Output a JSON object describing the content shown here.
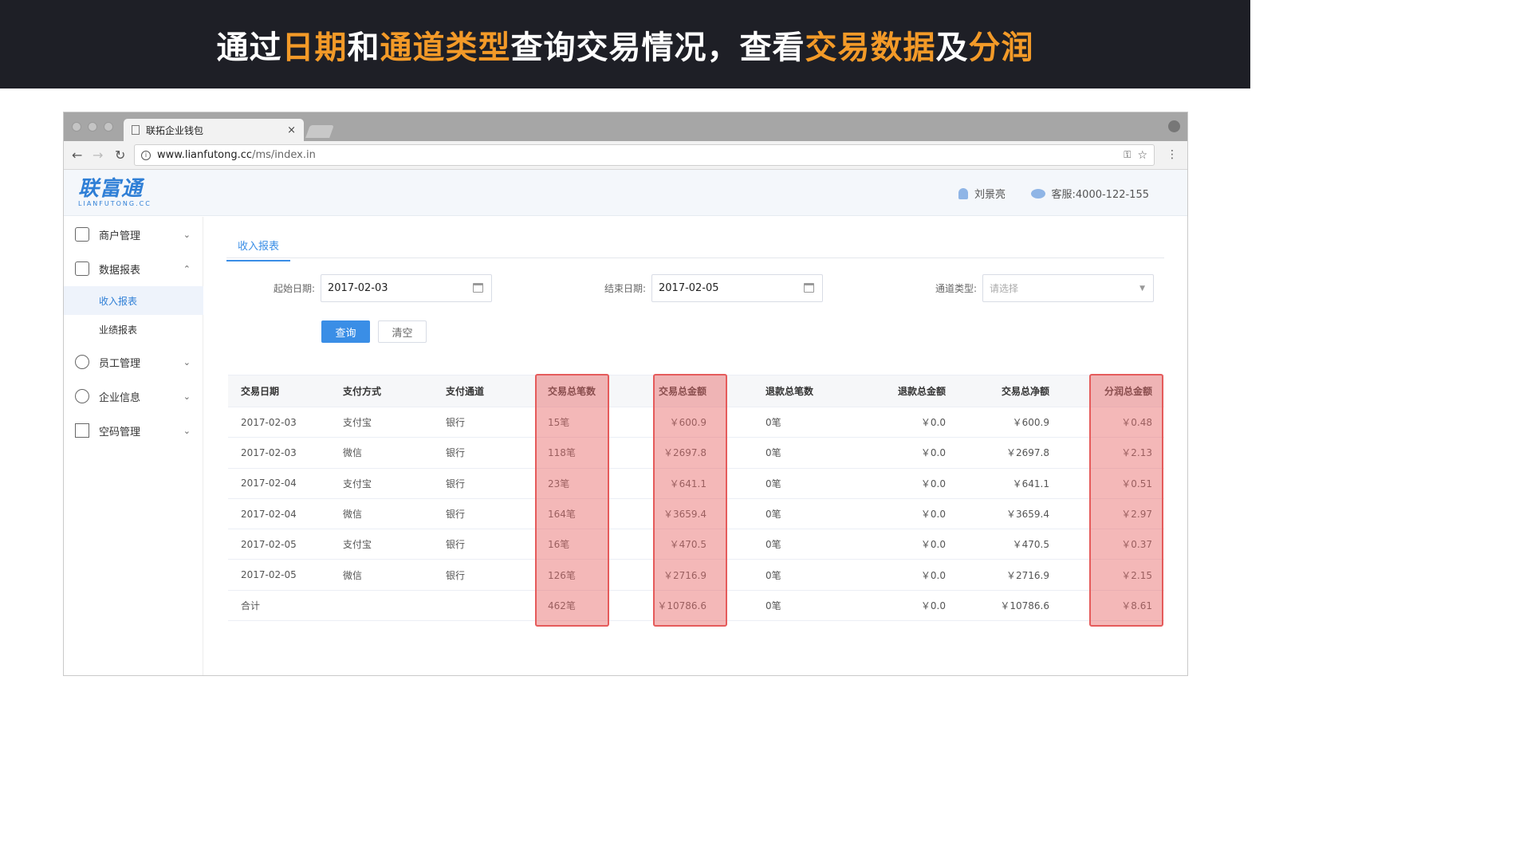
{
  "banner": {
    "parts": [
      {
        "text": "通过",
        "hl": false
      },
      {
        "text": "日期",
        "hl": true
      },
      {
        "text": "和",
        "hl": false
      },
      {
        "text": "通道类型",
        "hl": true
      },
      {
        "text": "查询交易情况，查看",
        "hl": false
      },
      {
        "text": "交易数据",
        "hl": true
      },
      {
        "text": "及",
        "hl": false
      },
      {
        "text": "分润",
        "hl": true
      }
    ]
  },
  "browser": {
    "tab_title": "联拓企业钱包",
    "close": "×",
    "url_host": "www.lianfutong.cc",
    "url_path": "/ms/index.in"
  },
  "header": {
    "logo_main": "联富通",
    "logo_sub": "LIANFUTONG.CC",
    "user_name": "刘景亮",
    "service": "客服:4000-122-155"
  },
  "sidebar": {
    "items": [
      {
        "label": "商户管理",
        "chev": "⌄"
      },
      {
        "label": "数据报表",
        "chev": "⌃"
      },
      {
        "label": "员工管理",
        "chev": "⌄"
      },
      {
        "label": "企业信息",
        "chev": "⌄"
      },
      {
        "label": "空码管理",
        "chev": "⌄"
      }
    ],
    "sub_items": [
      {
        "label": "收入报表"
      },
      {
        "label": "业绩报表"
      }
    ]
  },
  "main": {
    "tab": "收入报表",
    "filters": {
      "start_label": "起始日期:",
      "start_value": "2017-02-03",
      "end_label": "结束日期:",
      "end_value": "2017-02-05",
      "channel_label": "通道类型:",
      "channel_placeholder": "请选择"
    },
    "query_button": "查询",
    "clear_button": "清空"
  },
  "table": {
    "columns": [
      "交易日期",
      "支付方式",
      "支付通道",
      "交易总笔数",
      "交易总金额",
      "退款总笔数",
      "退款总金额",
      "交易总净额",
      "分润总金额"
    ],
    "rows": [
      [
        "2017-02-03",
        "支付宝",
        "银行",
        "15笔",
        "￥600.9",
        "0笔",
        "￥0.0",
        "￥600.9",
        "￥0.48"
      ],
      [
        "2017-02-03",
        "微信",
        "银行",
        "118笔",
        "￥2697.8",
        "0笔",
        "￥0.0",
        "￥2697.8",
        "￥2.13"
      ],
      [
        "2017-02-04",
        "支付宝",
        "银行",
        "23笔",
        "￥641.1",
        "0笔",
        "￥0.0",
        "￥641.1",
        "￥0.51"
      ],
      [
        "2017-02-04",
        "微信",
        "银行",
        "164笔",
        "￥3659.4",
        "0笔",
        "￥0.0",
        "￥3659.4",
        "￥2.97"
      ],
      [
        "2017-02-05",
        "支付宝",
        "银行",
        "16笔",
        "￥470.5",
        "0笔",
        "￥0.0",
        "￥470.5",
        "￥0.37"
      ],
      [
        "2017-02-05",
        "微信",
        "银行",
        "126笔",
        "￥2716.9",
        "0笔",
        "￥0.0",
        "￥2716.9",
        "￥2.15"
      ],
      [
        "合计",
        "",
        "",
        "462笔",
        "￥10786.6",
        "0笔",
        "￥0.0",
        "￥10786.6",
        "￥8.61"
      ]
    ]
  },
  "colors": {
    "accent": "#3a8ee6",
    "banner_bg": "#1e1f26",
    "banner_highlight": "#f39a28",
    "column_highlight": "#e55b5b"
  }
}
